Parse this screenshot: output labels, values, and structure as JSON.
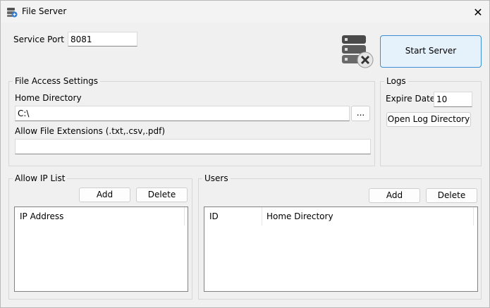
{
  "window": {
    "title": "File Server",
    "close_glyph": "✕"
  },
  "service": {
    "port_label": "Service Port :",
    "port_value": "8081"
  },
  "start_button": "Start Server",
  "file_access": {
    "group_title": "File Access Settings",
    "home_dir_label": "Home Directory",
    "home_dir_value": "C:\\",
    "browse_label": "...",
    "extensions_label": "Allow File Extensions (.txt,.csv,.pdf)",
    "extensions_value": ""
  },
  "logs": {
    "group_title": "Logs",
    "expire_label": "Expire Date",
    "expire_value": "10",
    "open_dir_label": "Open Log Directory"
  },
  "ip_list": {
    "group_title": "Allow IP List",
    "add_label": "Add",
    "delete_label": "Delete",
    "columns": [
      "IP Address"
    ]
  },
  "users": {
    "group_title": "Users",
    "add_label": "Add",
    "delete_label": "Delete",
    "columns": [
      "ID",
      "Home Directory"
    ]
  },
  "icons": {
    "app": "server-app-icon",
    "status": "server-stopped-icon"
  },
  "colors": {
    "primary_border": "#3c8fd4",
    "primary_fill": "#e5f1fb"
  }
}
